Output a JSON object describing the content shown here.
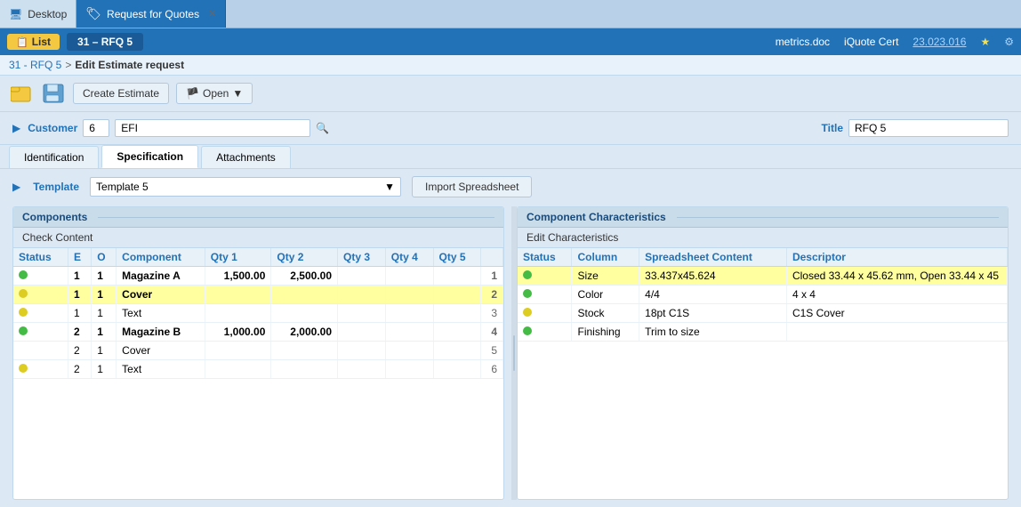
{
  "tabs": [
    {
      "label": "Desktop",
      "active": false,
      "icon": "desktop"
    },
    {
      "label": "Request for Quotes",
      "active": true,
      "icon": "rfq",
      "closeable": true
    }
  ],
  "navbar": {
    "list_label": "List",
    "rfq_label": "31 – RFQ 5",
    "metrics_doc": "metrics.doc",
    "iquote_cert": "iQuote Cert",
    "version": "23.023.016"
  },
  "breadcrumb": {
    "parent": "31 - RFQ 5",
    "separator": ">",
    "current": "Edit Estimate request"
  },
  "toolbar": {
    "create_estimate": "Create Estimate",
    "open": "Open"
  },
  "form": {
    "customer_label": "Customer",
    "customer_id": "6",
    "customer_name": "EFI",
    "title_label": "Title",
    "title_value": "RFQ 5"
  },
  "tabs_bar": [
    {
      "label": "Identification",
      "active": false
    },
    {
      "label": "Specification",
      "active": true
    },
    {
      "label": "Attachments",
      "active": false
    }
  ],
  "specification": {
    "template_label": "Template",
    "template_value": "Template 5",
    "import_btn": "Import Spreadsheet"
  },
  "components": {
    "panel_title": "Components",
    "sub_header": "Check Content",
    "columns": [
      "Status",
      "E",
      "O",
      "Component",
      "Qty 1",
      "Qty 2",
      "Qty 3",
      "Qty 4",
      "Qty 5",
      ""
    ],
    "rows": [
      {
        "status": "green",
        "e": "1",
        "o": "1",
        "component": "Magazine A",
        "qty1": "1,500.00",
        "qty2": "2,500.00",
        "qty3": "",
        "qty4": "",
        "qty5": "",
        "num": "1",
        "bold": true,
        "highlight": false
      },
      {
        "status": "yellow",
        "e": "1",
        "o": "1",
        "component": "Cover",
        "qty1": "",
        "qty2": "",
        "qty3": "",
        "qty4": "",
        "qty5": "",
        "num": "2",
        "bold": true,
        "highlight": true
      },
      {
        "status": "yellow",
        "e": "1",
        "o": "1",
        "component": "Text",
        "qty1": "",
        "qty2": "",
        "qty3": "",
        "qty4": "",
        "qty5": "",
        "num": "3",
        "bold": false,
        "highlight": false
      },
      {
        "status": "green",
        "e": "2",
        "o": "1",
        "component": "Magazine B",
        "qty1": "1,000.00",
        "qty2": "2,000.00",
        "qty3": "",
        "qty4": "",
        "qty5": "",
        "num": "4",
        "bold": true,
        "highlight": false
      },
      {
        "status": "",
        "e": "2",
        "o": "1",
        "component": "Cover",
        "qty1": "",
        "qty2": "",
        "qty3": "",
        "qty4": "",
        "qty5": "",
        "num": "5",
        "bold": false,
        "highlight": false
      },
      {
        "status": "yellow",
        "e": "2",
        "o": "1",
        "component": "Text",
        "qty1": "",
        "qty2": "",
        "qty3": "",
        "qty4": "",
        "qty5": "",
        "num": "6",
        "bold": false,
        "highlight": false
      }
    ]
  },
  "characteristics": {
    "panel_title": "Component Characteristics",
    "sub_header": "Edit Characteristics",
    "columns": [
      "Status",
      "Column",
      "Spreadsheet Content",
      "Descriptor"
    ],
    "rows": [
      {
        "status": "green",
        "column": "Size",
        "content": "33.437x45.624",
        "descriptor": "Closed 33.44 x 45.62 mm, Open 33.44 x 45",
        "highlight": true
      },
      {
        "status": "green",
        "column": "Color",
        "content": "4/4",
        "descriptor": "4 x 4",
        "highlight": false
      },
      {
        "status": "yellow",
        "column": "Stock",
        "content": "18pt C1S",
        "descriptor": "C1S Cover",
        "highlight": false
      },
      {
        "status": "green",
        "column": "Finishing",
        "content": "Trim to size",
        "descriptor": "",
        "highlight": false
      }
    ]
  }
}
